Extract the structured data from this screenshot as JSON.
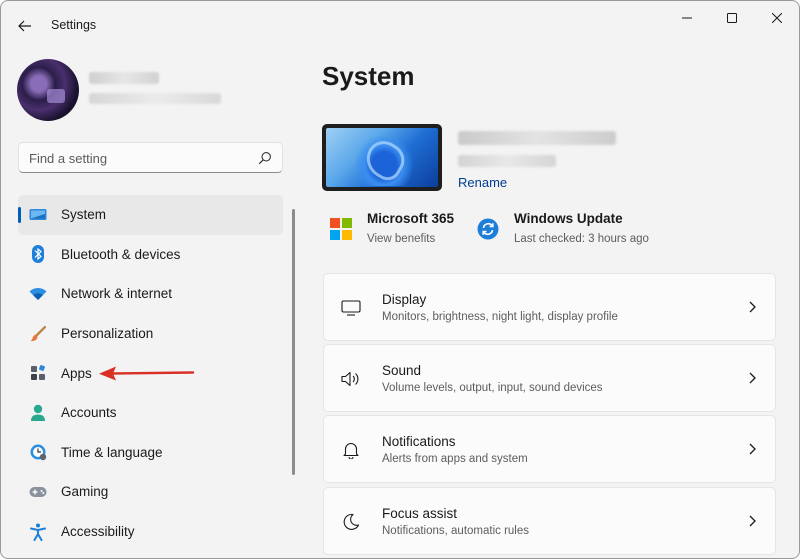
{
  "window": {
    "title": "Settings",
    "controls": [
      "minimize",
      "maximize",
      "close"
    ]
  },
  "profile": {
    "name": "•••••••",
    "email": "••••••••••••••••"
  },
  "search": {
    "placeholder": "Find a setting",
    "icon": "search-icon"
  },
  "sidebar": {
    "active": "System",
    "items": [
      {
        "label": "System",
        "icon": "system-icon"
      },
      {
        "label": "Bluetooth & devices",
        "icon": "bluetooth-icon"
      },
      {
        "label": "Network & internet",
        "icon": "network-icon"
      },
      {
        "label": "Personalization",
        "icon": "brush-icon"
      },
      {
        "label": "Apps",
        "icon": "apps-icon"
      },
      {
        "label": "Accounts",
        "icon": "accounts-icon"
      },
      {
        "label": "Time & language",
        "icon": "time-language-icon"
      },
      {
        "label": "Gaming",
        "icon": "gaming-icon"
      },
      {
        "label": "Accessibility",
        "icon": "accessibility-icon"
      }
    ]
  },
  "main": {
    "title": "System",
    "device": {
      "name": "•••••••••••••",
      "model": "••••••••",
      "rename": "Rename"
    },
    "quick": [
      {
        "title": "Microsoft 365",
        "subtitle": "View benefits",
        "icon": "microsoft-logo-icon"
      },
      {
        "title": "Windows Update",
        "subtitle": "Last checked: 3 hours ago",
        "icon": "windows-update-icon"
      }
    ],
    "cards": [
      {
        "title": "Display",
        "subtitle": "Monitors, brightness, night light, display profile",
        "icon": "display-icon"
      },
      {
        "title": "Sound",
        "subtitle": "Volume levels, output, input, sound devices",
        "icon": "speaker-icon"
      },
      {
        "title": "Notifications",
        "subtitle": "Alerts from apps and system",
        "icon": "bell-icon"
      },
      {
        "title": "Focus assist",
        "subtitle": "Notifications, automatic rules",
        "icon": "moon-icon"
      }
    ]
  },
  "colors": {
    "accent": "#005fb8",
    "link": "#003e92",
    "annotation_arrow": "#d93025",
    "window_bg": "#f3f3f3",
    "card_bg": "#fbfbfb"
  }
}
